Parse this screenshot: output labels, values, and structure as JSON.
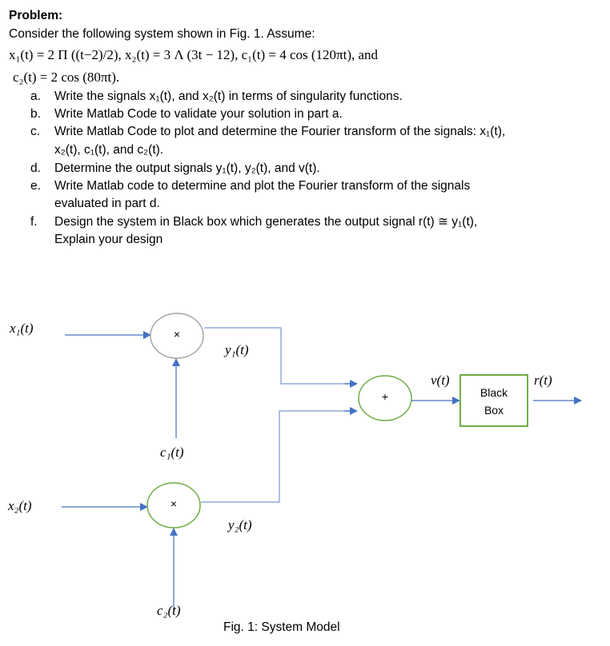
{
  "problem": {
    "heading": "Problem:",
    "intro": "Consider the following system shown in Fig. 1. Assume:",
    "equations_line1": "x₁(t) = 2 Π ((t−2)/2), x₂(t) = 3 Λ (3t − 12), c₁(t) = 4 cos (120πt), and",
    "equations_line2": "c₂(t) = 2 cos (80πt).",
    "items": [
      {
        "label": "a.",
        "lines": [
          "Write the signals x₁(t), and  x₂(t) in terms of singularity functions."
        ]
      },
      {
        "label": "b.",
        "lines": [
          "Write Matlab Code to validate your solution in part a."
        ]
      },
      {
        "label": "c.",
        "lines": [
          "Write Matlab Code to plot and determine the Fourier transform of the signals: x₁(t),",
          "x₂(t), c₁(t), and c₂(t)."
        ]
      },
      {
        "label": "d.",
        "lines": [
          "Determine the output signals y₁(t), y₂(t), and v(t)."
        ]
      },
      {
        "label": "e.",
        "lines": [
          "Write Matlab code to determine and plot the Fourier transform of the signals",
          "evaluated in part d."
        ]
      },
      {
        "label": "f.",
        "lines": [
          "Design the system in Black box which generates the output signal r(t) ≅ y₁(t),",
          "Explain your design"
        ]
      }
    ]
  },
  "diagram": {
    "signals": {
      "x1": "x₁(t)",
      "x2": "x₂(t)",
      "c1": "c₁(t)",
      "c2": "c₂(t)",
      "y1": "y₁(t)",
      "y2": "y₂(t)",
      "v": "v(t)",
      "r": "r(t)"
    },
    "multiplier_symbol": "×",
    "adder_symbol": "+",
    "black_box_line1": "Black",
    "black_box_line2": "Box",
    "caption": "Fig. 1: System Model",
    "colors": {
      "wire": "#4472c4",
      "wire_light": "#8faadc",
      "multiplier1_border": "#a6a6a6",
      "green_border": "#70ad47"
    }
  }
}
